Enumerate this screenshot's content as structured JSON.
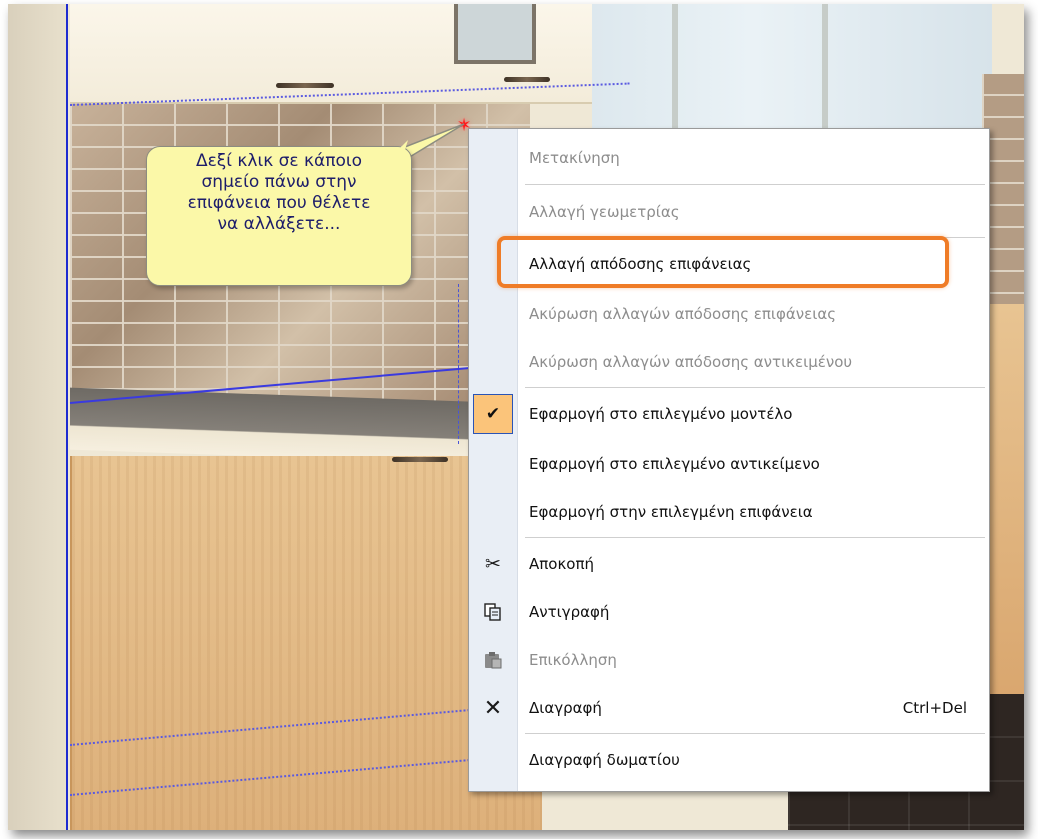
{
  "callout": {
    "text": "Δεξί κλικ σε κάποιο\nσημείο πάνω στην\nεπιφάνεια που θέλετε\nνα αλλάξετε..."
  },
  "menu": {
    "items": [
      {
        "label": "Μετακίνηση",
        "enabled": false,
        "icon": ""
      },
      {
        "label": "Αλλαγή γεωμετρίας",
        "enabled": false,
        "icon": ""
      },
      {
        "label": "Αλλαγή απόδοσης επιφάνειας",
        "enabled": true,
        "icon": "",
        "highlighted": true
      },
      {
        "label": "Ακύρωση αλλαγών απόδοσης επιφάνειας",
        "enabled": false,
        "icon": ""
      },
      {
        "label": "Ακύρωση αλλαγών απόδοσης αντικειμένου",
        "enabled": false,
        "icon": ""
      },
      {
        "label": "Εφαρμογή στο επιλεγμένο μοντέλο",
        "enabled": true,
        "checked": true,
        "icon": "check-icon"
      },
      {
        "label": "Εφαρμογή στο επιλεγμένο αντικείμενο",
        "enabled": true,
        "icon": ""
      },
      {
        "label": "Εφαρμογή στην επιλεγμένη επιφάνεια",
        "enabled": true,
        "icon": ""
      },
      {
        "label": "Αποκοπή",
        "enabled": true,
        "icon": "scissors-icon"
      },
      {
        "label": "Αντιγραφή",
        "enabled": true,
        "icon": "copy-icon"
      },
      {
        "label": "Επικόλληση",
        "enabled": false,
        "icon": "paste-icon"
      },
      {
        "label": "Διαγραφή",
        "enabled": true,
        "icon": "delete-x-icon",
        "shortcut": "Ctrl+Del"
      },
      {
        "label": "Διαγραφή δωματίου",
        "enabled": true,
        "icon": ""
      }
    ],
    "icons": {
      "check-icon": "✔",
      "scissors-icon": "✂",
      "copy-icon": "⎘",
      "paste-icon": "📋",
      "delete-x-icon": "✕"
    }
  },
  "colors": {
    "highlight_ring": "#ef7c27",
    "callout_bg": "#fbf8a8",
    "callout_text": "#1d1d6a",
    "checked_bg": "#fbc47a",
    "guide_lines": "#1e2bd0"
  }
}
